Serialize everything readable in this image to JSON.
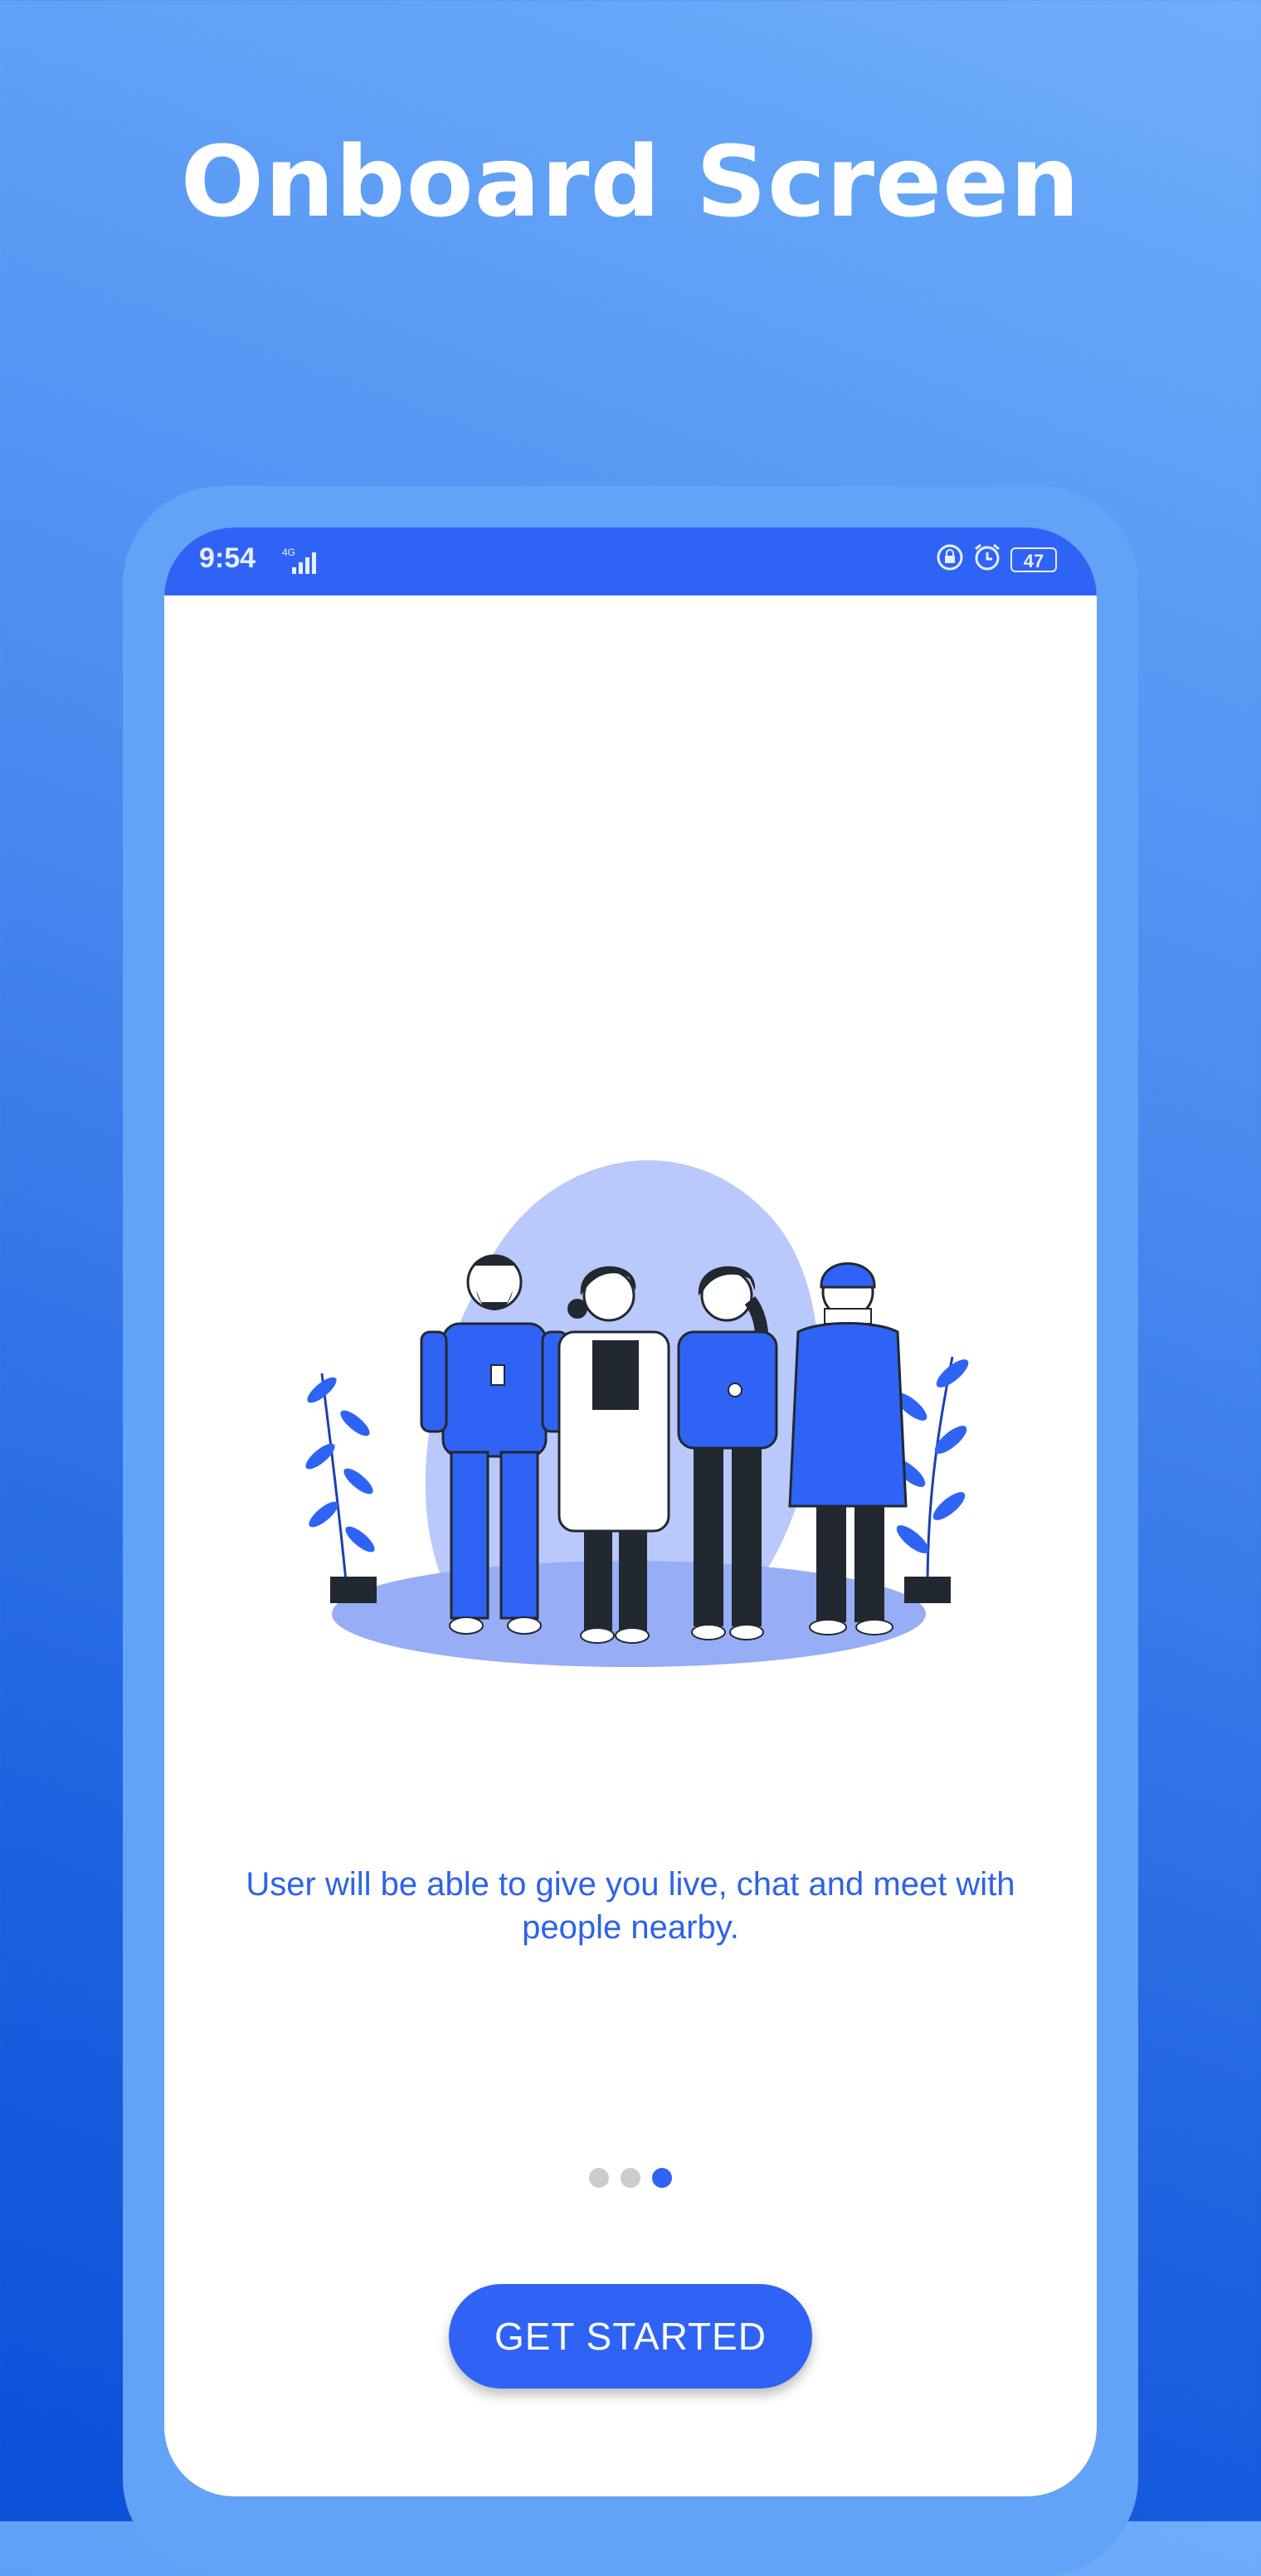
{
  "headline": "Onboard Screen",
  "status_bar": {
    "time": "9:54",
    "network": "4G",
    "battery": "47",
    "icons": [
      "lock-rotation-icon",
      "alarm-icon",
      "battery-icon",
      "signal-icon"
    ]
  },
  "onboarding": {
    "description": "User will be able to give you live, chat and meet with people nearby.",
    "page_count": 3,
    "active_page": 3,
    "cta_label": "GET STARTED"
  },
  "colors": {
    "accent": "#2f63f5",
    "frame": "#62a2f7",
    "text": "#2e62e8",
    "dot_inactive": "#cccccc"
  }
}
